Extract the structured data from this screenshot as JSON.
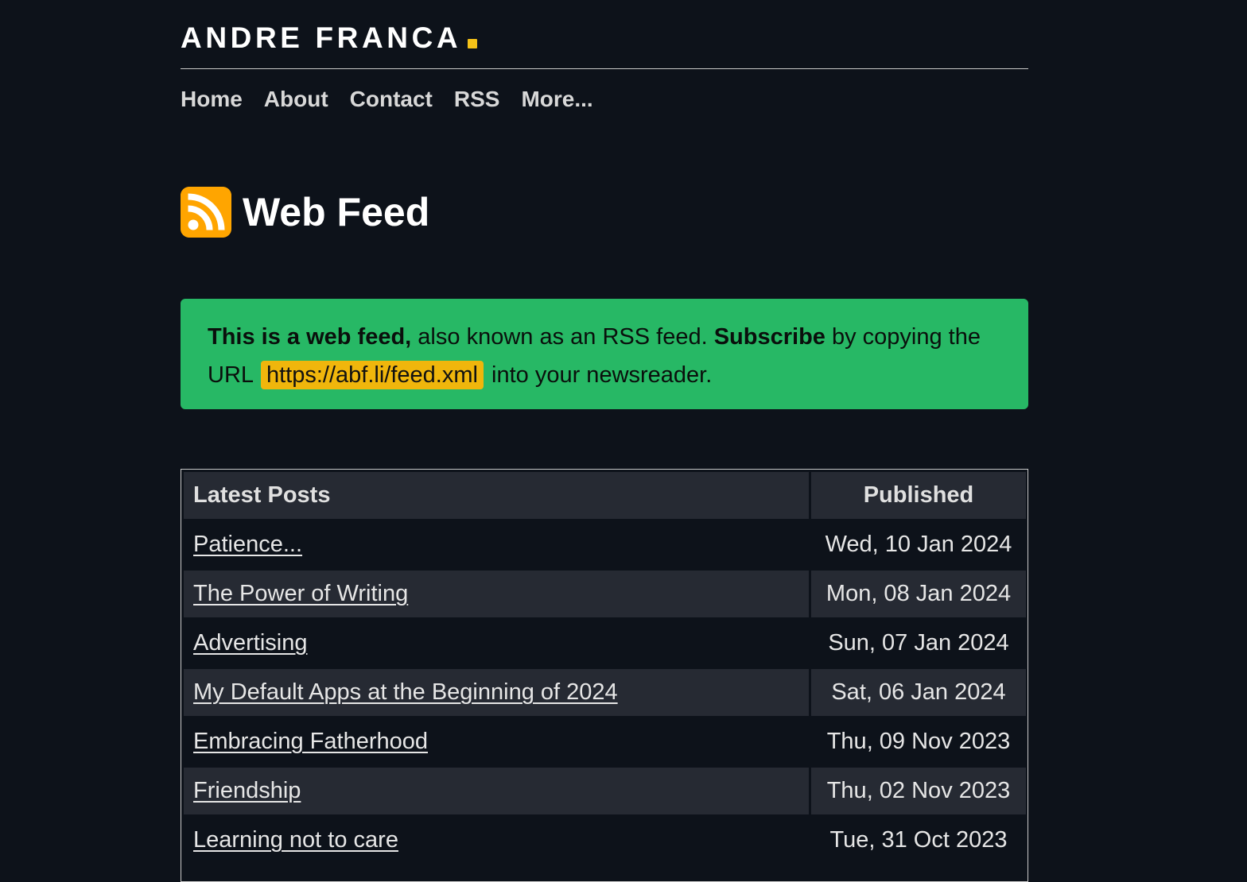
{
  "site": {
    "title": "ANDRE FRANCA",
    "accent_color": "#f5c218"
  },
  "nav": [
    {
      "label": "Home"
    },
    {
      "label": "About"
    },
    {
      "label": "Contact"
    },
    {
      "label": "RSS"
    },
    {
      "label": "More..."
    }
  ],
  "page": {
    "icon": "rss-icon",
    "title": "Web Feed"
  },
  "notice": {
    "lead_bold": "This is a web feed,",
    "text1": " also known as an RSS feed. ",
    "subscribe_bold": "Subscribe",
    "text2": " by copying the URL ",
    "url": "https://abf.li/feed.xml",
    "text3": " into your newsreader.",
    "background": "#27b865",
    "url_highlight": "#f0b60c"
  },
  "table": {
    "headers": {
      "posts": "Latest Posts",
      "published": "Published"
    },
    "rows": [
      {
        "title": "Patience...",
        "date": "Wed, 10 Jan 2024"
      },
      {
        "title": "The Power of Writing",
        "date": "Mon, 08 Jan 2024"
      },
      {
        "title": "Advertising",
        "date": "Sun, 07 Jan 2024"
      },
      {
        "title": "My Default Apps at the Beginning of 2024",
        "date": "Sat, 06 Jan 2024"
      },
      {
        "title": "Embracing Fatherhood",
        "date": "Thu, 09 Nov 2023"
      },
      {
        "title": "Friendship",
        "date": "Thu, 02 Nov 2023"
      },
      {
        "title": "Learning not to care",
        "date": "Tue, 31 Oct 2023"
      }
    ]
  }
}
